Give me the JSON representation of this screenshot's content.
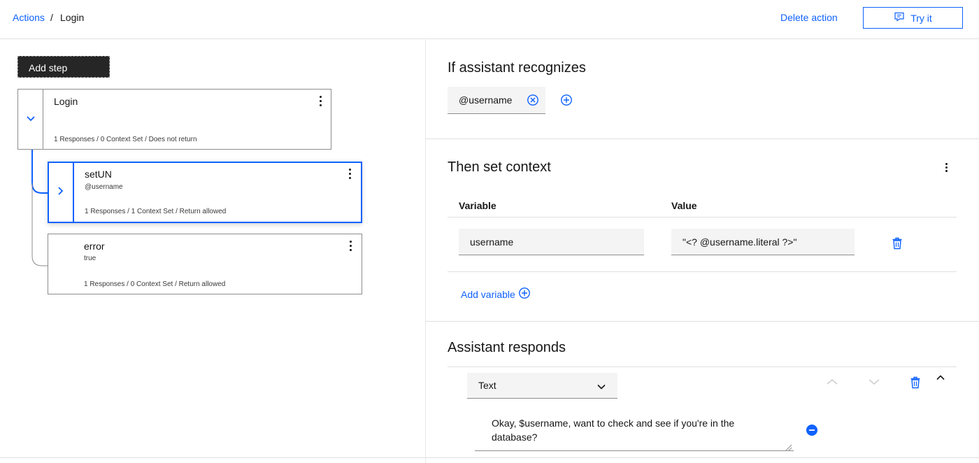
{
  "breadcrumb": {
    "parent": "Actions",
    "separator": "/",
    "current": "Login"
  },
  "header": {
    "delete_label": "Delete action",
    "try_label": "Try it"
  },
  "tree": {
    "add_step_label": "Add step",
    "nodes": [
      {
        "title": "Login",
        "condition": "",
        "meta": "1 Responses / 0 Context Set / Does not return",
        "expanded": true
      },
      {
        "title": "setUN",
        "condition": "@username",
        "meta": "1 Responses / 1 Context Set / Return allowed",
        "selected": true
      },
      {
        "title": "error",
        "condition": "true",
        "meta": "1 Responses / 0 Context Set / Return allowed"
      }
    ]
  },
  "recognizes": {
    "title": "If assistant recognizes",
    "chip": "@username"
  },
  "context": {
    "title": "Then set context",
    "col_variable": "Variable",
    "col_value": "Value",
    "rows": [
      {
        "variable": "username",
        "value": "\"<? @username.literal ?>\""
      }
    ],
    "add_label": "Add variable"
  },
  "responds": {
    "title": "Assistant responds",
    "type": "Text",
    "text": "Okay, $username, want to check and see if you're in the database?"
  },
  "colors": {
    "accent": "#0f62fe",
    "text": "#161616",
    "border": "#8d8d8d",
    "field_bg": "#f4f4f4",
    "dark_button": "#262626"
  }
}
